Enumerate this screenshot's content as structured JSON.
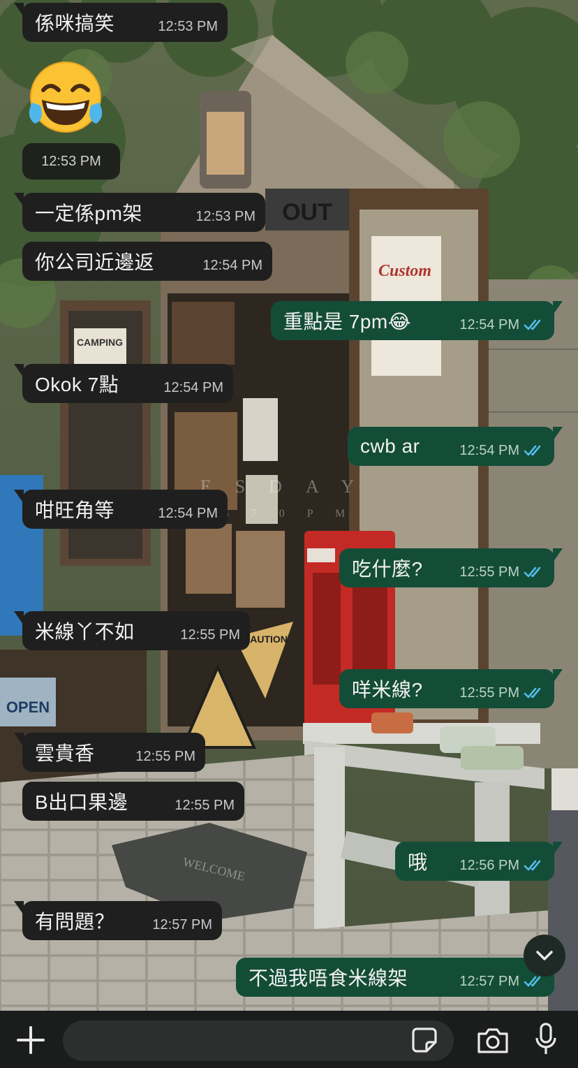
{
  "wallpaper": {
    "sign_custom": "Custom",
    "sign_camping": "CAMPING",
    "sign_caution": "CAUTION",
    "sign_out": "OUT",
    "mat_welcome": "WELCOME",
    "watermark_top": "ESDAY",
    "watermark_bottom": "5 7 0 P M",
    "sign_open": "OPEN"
  },
  "chat": {
    "emoji_symbol": "😂",
    "emoji_time": "12:53 PM",
    "messages": [
      {
        "text": "係咪搞笑",
        "time": "12:53 PM",
        "dir": "in"
      },
      {
        "text": "一定係pm架",
        "time": "12:53 PM",
        "dir": "in"
      },
      {
        "text": "你公司近邊返",
        "time": "12:54 PM",
        "dir": "in"
      },
      {
        "text": "重點是 7pm😂",
        "time": "12:54 PM",
        "dir": "out",
        "status": "read"
      },
      {
        "text": "Okok 7點",
        "time": "12:54 PM",
        "dir": "in"
      },
      {
        "text": "cwb ar",
        "time": "12:54 PM",
        "dir": "out",
        "status": "read"
      },
      {
        "text": "咁旺角等",
        "time": "12:54 PM",
        "dir": "in"
      },
      {
        "text": "吃什麼?",
        "time": "12:55 PM",
        "dir": "out",
        "status": "read"
      },
      {
        "text": "米線丫不如",
        "time": "12:55 PM",
        "dir": "in"
      },
      {
        "text": "咩米線?",
        "time": "12:55 PM",
        "dir": "out",
        "status": "read"
      },
      {
        "text": "雲貴香",
        "time": "12:55 PM",
        "dir": "in"
      },
      {
        "text": "B出口果邊",
        "time": "12:55 PM",
        "dir": "in"
      },
      {
        "text": "哦",
        "time": "12:56 PM",
        "dir": "out",
        "status": "read"
      },
      {
        "text": "有問題？",
        "time": "12:57 PM",
        "dir": "in"
      },
      {
        "text": "不過我唔食米線架",
        "time": "12:57 PM",
        "dir": "out",
        "status": "read"
      }
    ]
  },
  "input_bar": {
    "placeholder": "",
    "icons": [
      "plus-icon",
      "sticker-icon",
      "camera-icon",
      "microphone-icon"
    ]
  },
  "colors": {
    "incoming_bubble": "#1f1f1f",
    "outgoing_bubble": "#144d37",
    "read_ticks": "#53bdeb"
  }
}
